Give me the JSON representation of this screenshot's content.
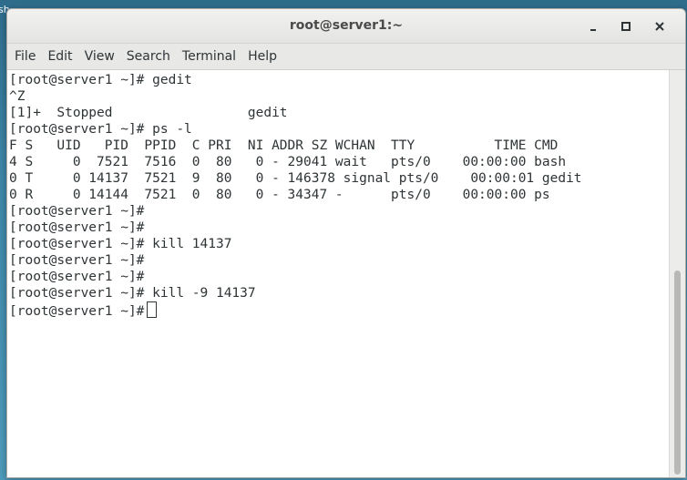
{
  "desktop": {
    "edge_text": "sh"
  },
  "window": {
    "title": "root@server1:~",
    "controls": {
      "minimize_icon": "minimize-icon",
      "maximize_icon": "maximize-icon",
      "close_icon": "close-icon"
    }
  },
  "menu": {
    "items": [
      "File",
      "Edit",
      "View",
      "Search",
      "Terminal",
      "Help"
    ]
  },
  "terminal": {
    "lines": [
      "[root@server1 ~]# gedit",
      "^Z",
      "[1]+  Stopped                 gedit",
      "[root@server1 ~]# ps -l",
      "F S   UID   PID  PPID  C PRI  NI ADDR SZ WCHAN  TTY          TIME CMD",
      "4 S     0  7521  7516  0  80   0 - 29041 wait   pts/0    00:00:00 bash",
      "0 T     0 14137  7521  9  80   0 - 146378 signal pts/0    00:00:01 gedit",
      "0 R     0 14144  7521  0  80   0 - 34347 -      pts/0    00:00:00 ps",
      "[root@server1 ~]#",
      "[root@server1 ~]#",
      "[root@server1 ~]# kill 14137",
      "[root@server1 ~]#",
      "[root@server1 ~]#",
      "[root@server1 ~]# kill -9 14137",
      "[root@server1 ~]#"
    ]
  },
  "colors": {
    "terminal_text": "#2e3436",
    "terminal_bg": "#ffffff",
    "titlebar_bg": "#e8e8e7",
    "desktop_bg": "#3d86a8"
  }
}
